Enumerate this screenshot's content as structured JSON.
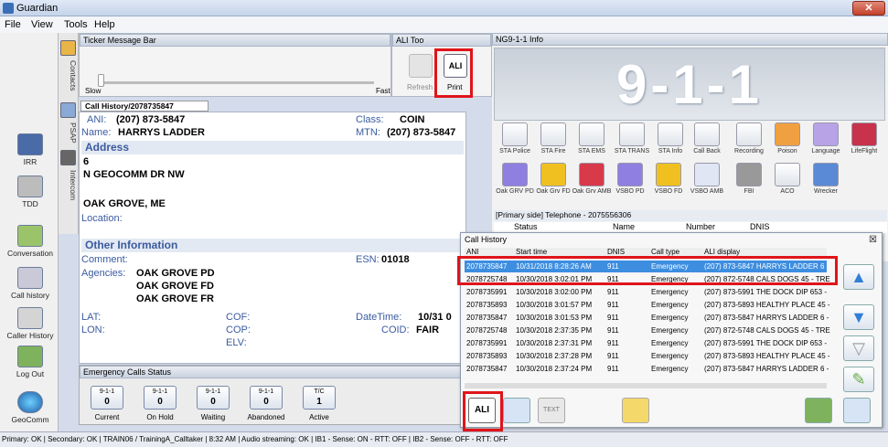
{
  "window": {
    "title": "Guardian",
    "close": "✕"
  },
  "menu": [
    "File",
    "View",
    "Tools",
    "Help"
  ],
  "left_sidebar": [
    "IRR",
    "TDD",
    "Conversation",
    "Call history",
    "Caller History",
    "Log Out",
    "GeoComm"
  ],
  "side_tabs": [
    "Contacts",
    "PSAP",
    "Intercom"
  ],
  "ticker": {
    "title": "Ticker Message Bar",
    "slow": "Slow",
    "fast": "Fast"
  },
  "ali_tools": {
    "title": "ALI Too",
    "refresh": "Refresh",
    "print": "Print"
  },
  "caller": {
    "tab": "Call History/2078735847",
    "ani_label": "ANI:",
    "ani": "(207) 873-5847",
    "class_label": "Class:",
    "class": "COIN",
    "name_label": "Name:",
    "name": "HARRYS LADDER",
    "mtn_label": "MTN:",
    "mtn": "(207) 873-5847",
    "address_header": "Address",
    "house": "6",
    "street": "N GEOCOMM DR NW",
    "city": "OAK GROVE, ME",
    "location_label": "Location:",
    "other_header": "Other Information",
    "comment_label": "Comment:",
    "esn_label": "ESN:",
    "esn": "01018",
    "agencies_label": "Agencies:",
    "agencies": [
      "OAK GROVE PD",
      "OAK GROVE FD",
      "OAK GROVE FR"
    ],
    "lat_label": "LAT:",
    "lon_label": "LON:",
    "cof_label": "COF:",
    "cop_label": "COP:",
    "elv_label": "ELV:",
    "datetime_label": "DateTime:",
    "datetime": "10/31 0",
    "coid_label": "COID:",
    "coid": "FAIR"
  },
  "emergency_status": {
    "title": "Emergency Calls Status",
    "boxes": [
      {
        "top": "9-1-1",
        "count": "0",
        "label": "Current"
      },
      {
        "top": "9-1-1",
        "count": "0",
        "label": "On Hold"
      },
      {
        "top": "9-1-1",
        "count": "0",
        "label": "Waiting"
      },
      {
        "top": "9-1-1",
        "count": "0",
        "label": "Abandoned"
      },
      {
        "top": "T/C",
        "count": "1",
        "label": "Active"
      }
    ]
  },
  "ng911": {
    "title": "NG9-1-1 Info",
    "banner": "9-1-1",
    "row1": [
      "STA Police",
      "STA Fire",
      "STA EMS",
      "STA TRANS",
      "STA Info",
      "Call Back",
      "Recording",
      "Poison",
      "Language",
      "LifeFlight"
    ],
    "row2": [
      "Oak GRV PD",
      "Oak Grv FD",
      "Oak Grv AMB",
      "VSBO PD",
      "VSBO FD",
      "VSBO AMB",
      "FBI",
      "ACO",
      "Wrecker"
    ],
    "telephone": "[Primary side] Telephone - 2075556306",
    "cols": [
      "Status",
      "Name",
      "Number",
      "DNIS"
    ]
  },
  "call_history": {
    "title": "Call History",
    "close": "☒",
    "headers": [
      "ANI",
      "Start time",
      "DNIS",
      "Call type",
      "ALI display"
    ],
    "rows": [
      {
        "ani": "2078735847",
        "time": "10/31/2018 8:28:26 AM",
        "dnis": "911",
        "type": "Emergency",
        "ali": "(207) 873-5847 HARRYS LADDER 6 -"
      },
      {
        "ani": "2078725748",
        "time": "10/30/2018 3:02:01 PM",
        "dnis": "911",
        "type": "Emergency",
        "ali": "(207) 872-5748 CALS DOGS 45 - TRE"
      },
      {
        "ani": "2078735991",
        "time": "10/30/2018 3:02:00 PM",
        "dnis": "911",
        "type": "Emergency",
        "ali": "(207) 873-5991 THE DOCK DIP 653 -"
      },
      {
        "ani": "2078735893",
        "time": "10/30/2018 3:01:57 PM",
        "dnis": "911",
        "type": "Emergency",
        "ali": "(207) 873-5893 HEALTHY PLACE 45 -"
      },
      {
        "ani": "2078735847",
        "time": "10/30/2018 3:01:53 PM",
        "dnis": "911",
        "type": "Emergency",
        "ali": "(207) 873-5847 HARRYS LADDER 6 -"
      },
      {
        "ani": "2078725748",
        "time": "10/30/2018 2:37:35 PM",
        "dnis": "911",
        "type": "Emergency",
        "ali": "(207) 872-5748 CALS DOGS 45 - TRE"
      },
      {
        "ani": "2078735991",
        "time": "10/30/2018 2:37:31 PM",
        "dnis": "911",
        "type": "Emergency",
        "ali": "(207) 873-5991 THE DOCK DIP 653 -"
      },
      {
        "ani": "2078735893",
        "time": "10/30/2018 2:37:28 PM",
        "dnis": "911",
        "type": "Emergency",
        "ali": "(207) 873-5893 HEALTHY PLACE 45 -"
      },
      {
        "ani": "2078735847",
        "time": "10/30/2018 2:37:24 PM",
        "dnis": "911",
        "type": "Emergency",
        "ali": "(207) 873-5847 HARRYS LADDER 6 -"
      }
    ],
    "ali_button": "ALI",
    "text_button": "TEXT"
  },
  "statusbar": "Primary: OK | Secondary: OK | TRAIN06 / TrainingA_Calltaker | 8:32 AM | Audio streaming: OK | IB1 - Sense: ON - RTT: OFF | IB2 - Sense: OFF - RTT: OFF"
}
